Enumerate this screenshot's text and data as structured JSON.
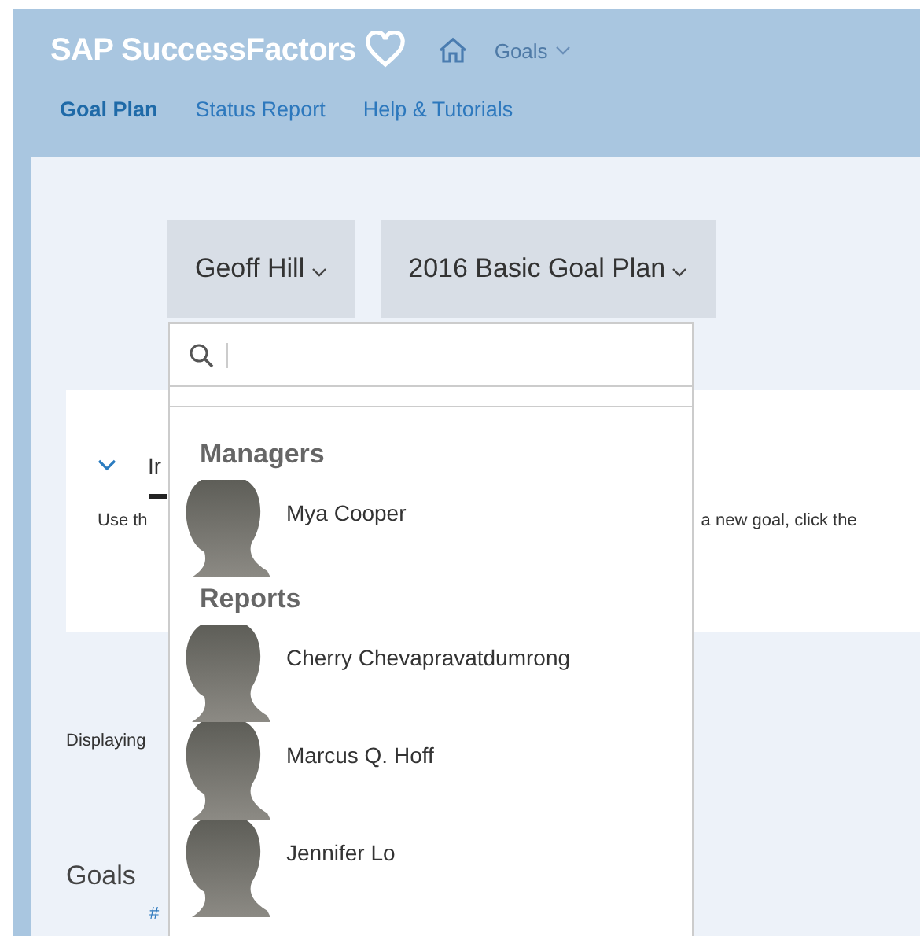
{
  "header": {
    "logo": "SAP SuccessFactors",
    "nav_menu": "Goals"
  },
  "tabs": [
    {
      "label": "Goal Plan",
      "selected": true
    },
    {
      "label": "Status Report",
      "selected": false
    },
    {
      "label": "Help & Tutorials",
      "selected": false
    }
  ],
  "selectors": [
    {
      "label": "Geoff Hill"
    },
    {
      "label": "2016 Basic Goal Plan"
    }
  ],
  "background": {
    "card_title": "Ir",
    "description_left": "Use th",
    "description_right": "a new goal, click the",
    "displaying": "Displaying",
    "goals_heading": "Goals",
    "column_1": "#"
  },
  "dropdown": {
    "groups": [
      {
        "heading": "Managers",
        "people": [
          "Mya Cooper"
        ]
      },
      {
        "heading": "Reports",
        "people": [
          "Cherry Chevapravatdumrong",
          "Marcus Q. Hoff",
          "Jennifer Lo"
        ]
      }
    ]
  }
}
